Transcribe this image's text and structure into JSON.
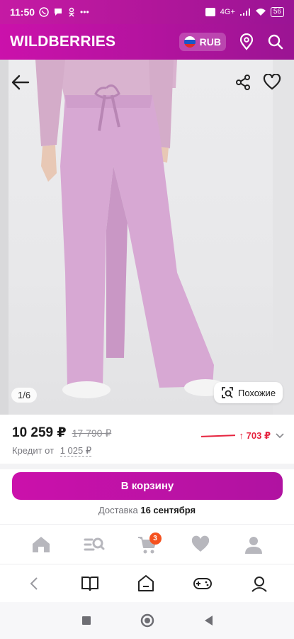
{
  "status_bar": {
    "time": "11:50",
    "network": "4G+",
    "battery": "56"
  },
  "header": {
    "logo": "WILDBERRIES",
    "currency": "RUB"
  },
  "gallery": {
    "counter": "1/6",
    "similar_label": "Похожие"
  },
  "product": {
    "price": "10 259 ₽",
    "old_price": "17 790 ₽",
    "price_change": "↑ 703 ₽",
    "credit_label": "Кредит от",
    "credit_amount": "1 025 ₽"
  },
  "actions": {
    "cart_button": "В корзину",
    "delivery_label": "Доставка",
    "delivery_date": "16 сентября"
  },
  "tabbar": {
    "cart_badge": "3"
  },
  "colors": {
    "brand": "#cb11ab",
    "price_up": "#e6243f",
    "badge": "#f5511e"
  }
}
